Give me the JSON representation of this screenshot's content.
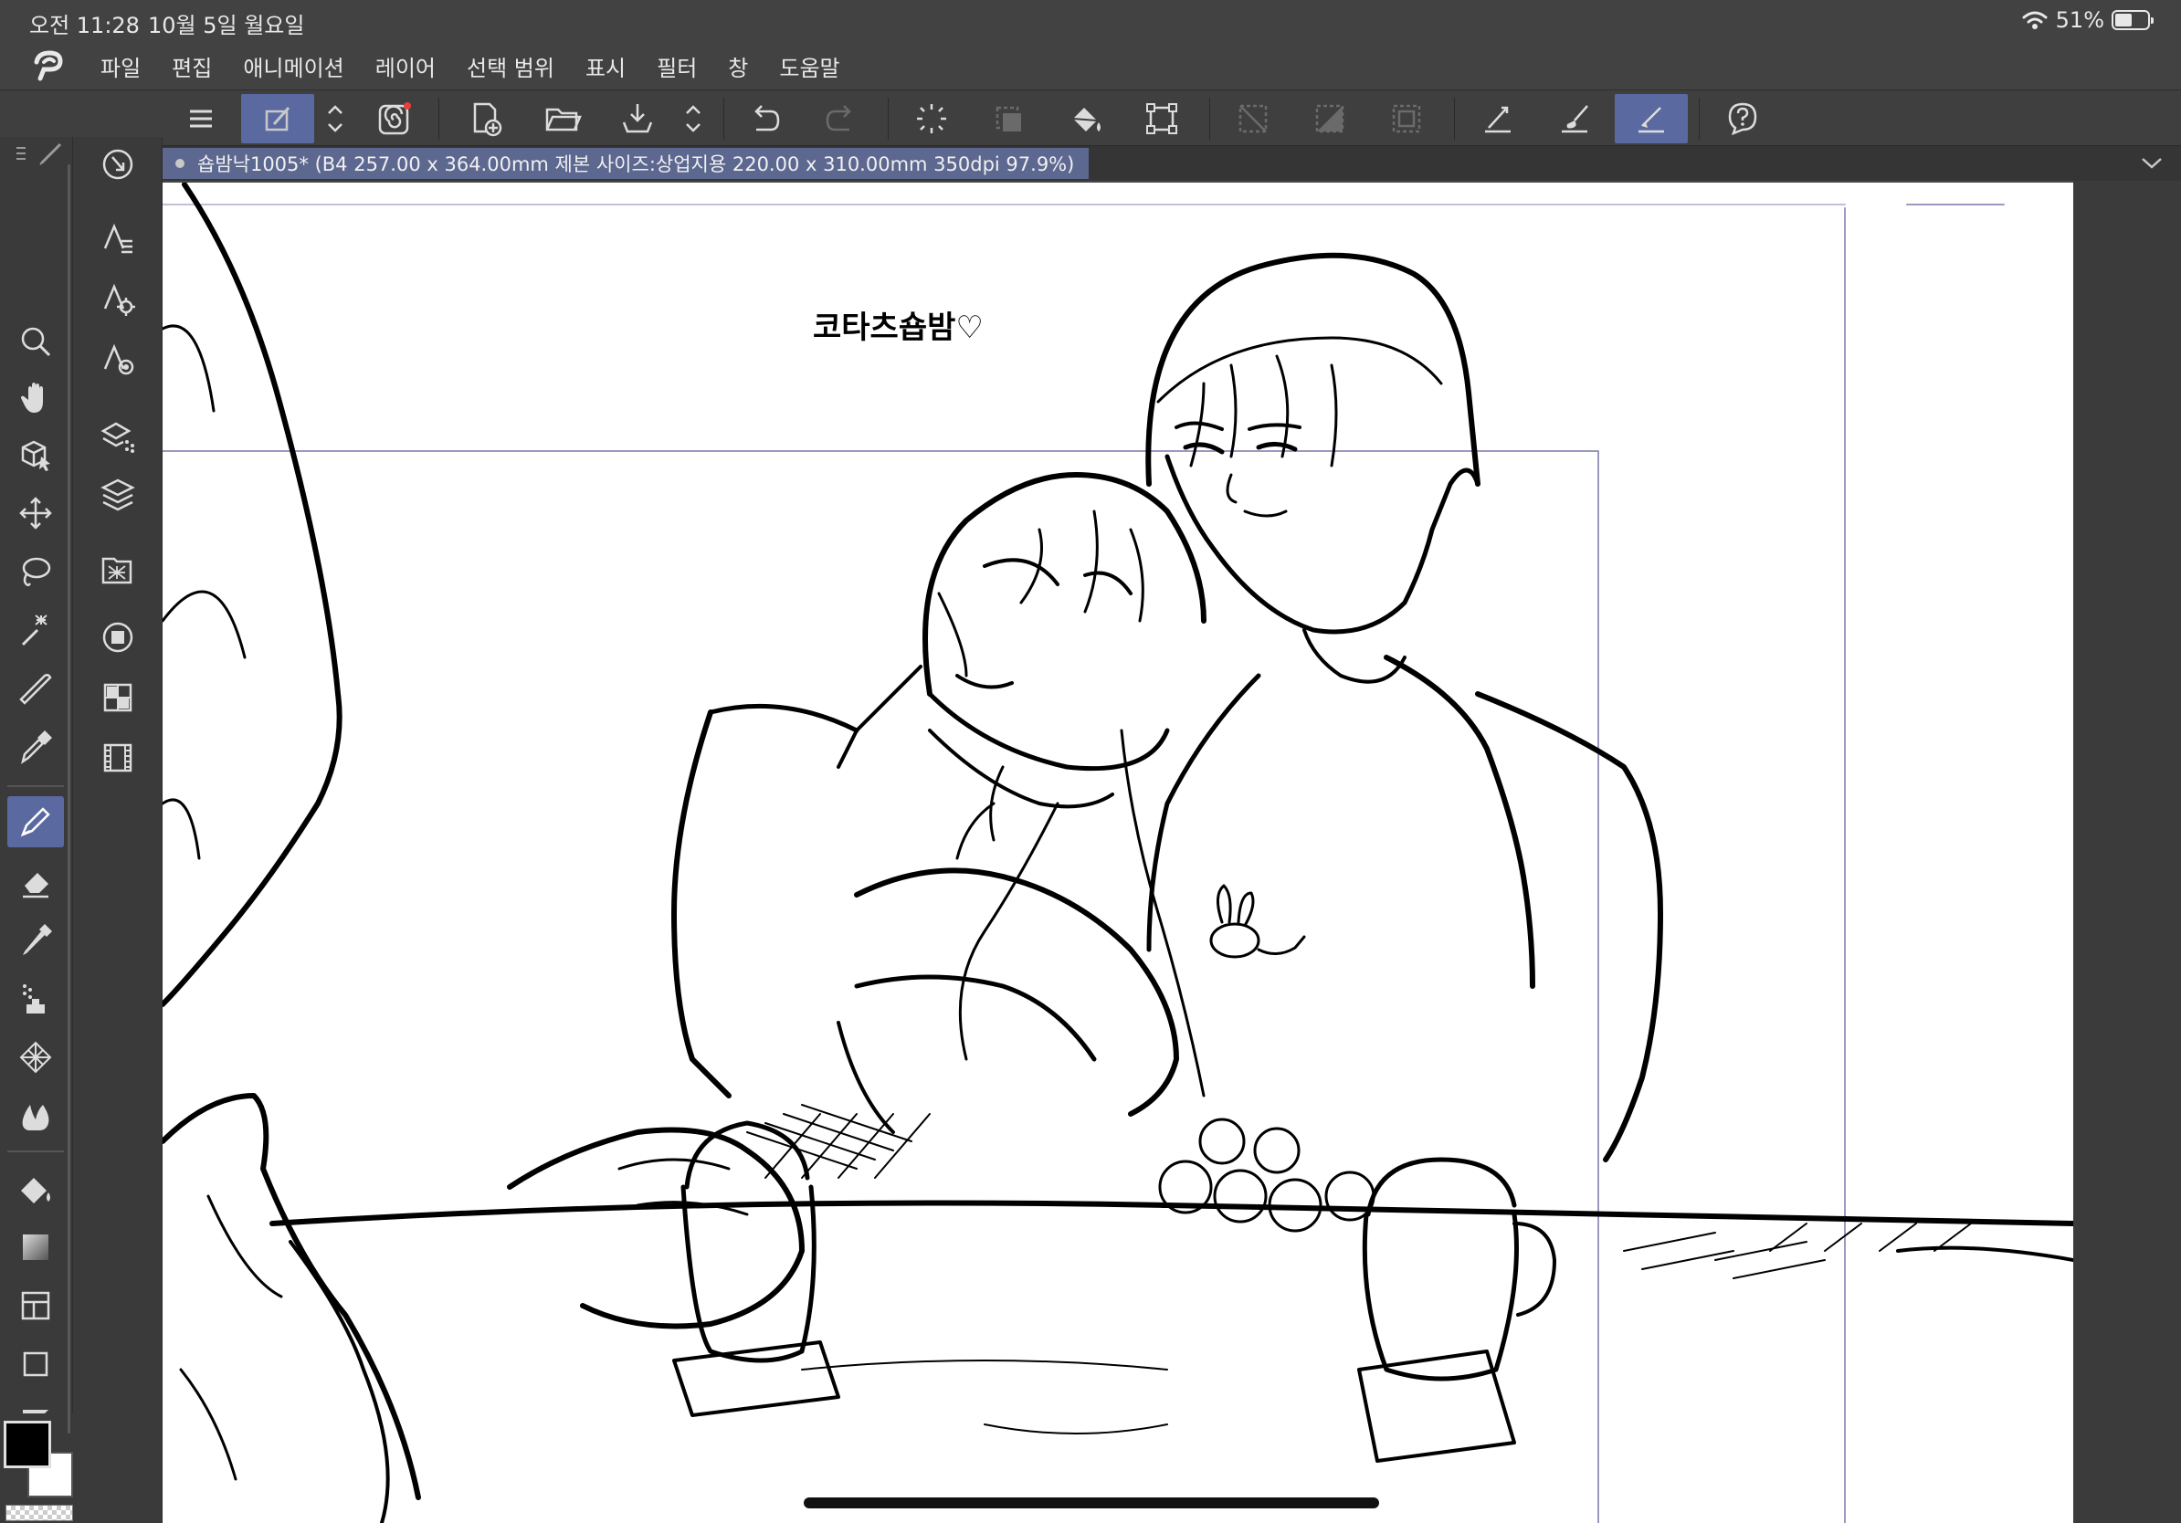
{
  "status_bar": {
    "time": "오전 11:28",
    "date": "10월 5일 월요일",
    "battery": "51%",
    "battery_level": 0.51
  },
  "menu": {
    "items": [
      "파일",
      "편집",
      "애니메이션",
      "레이어",
      "선택 범위",
      "표시",
      "필터",
      "창",
      "도움말"
    ]
  },
  "toolbar": {
    "icons": [
      "menu-icon",
      "pen-settings-icon",
      "swap-icon",
      "spiral-icon",
      "new-canvas-icon",
      "open-folder-icon",
      "save-icon",
      "undo-icon",
      "redo-icon",
      "select-all-icon",
      "deselect-icon",
      "fill-icon",
      "transform-icon",
      "crop-icon",
      "shade-icon",
      "frame-icon",
      "ruler-pen-icon",
      "brush-icon",
      "active-ruler-icon",
      "help-icon"
    ]
  },
  "document": {
    "tab_label": "숍밤낙1005* (B4 257.00 x 364.00mm 제본 사이즈:상업지용 220.00 x 310.00mm 350dpi 97.9%)"
  },
  "canvas": {
    "handwritten_text": "코타츠숍밤♡"
  },
  "colors": {
    "accent": "#5a6aa0",
    "main_color": "#000000",
    "sub_color": "#ffffff"
  }
}
